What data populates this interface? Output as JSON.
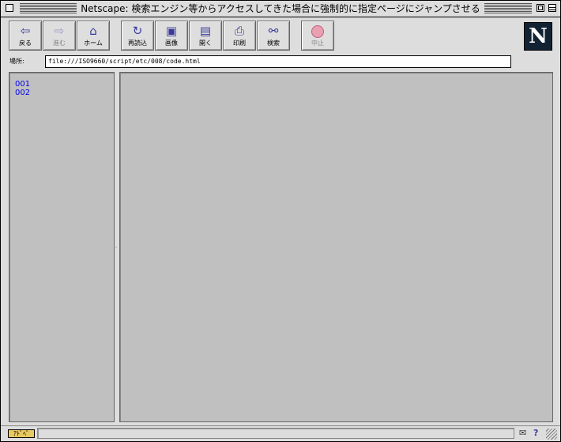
{
  "window": {
    "title": "Netscape: 検索エンジン等からアクセスしてきた場合に強制的に指定ページにジャンプさせる"
  },
  "toolbar": {
    "buttons": [
      {
        "label": "戻る",
        "icon": "back-arrow-icon"
      },
      {
        "label": "進む",
        "icon": "forward-arrow-icon"
      },
      {
        "label": "ホーム",
        "icon": "home-icon"
      },
      {
        "label": "再読込",
        "icon": "reload-icon"
      },
      {
        "label": "画像",
        "icon": "images-icon"
      },
      {
        "label": "開く",
        "icon": "open-icon"
      },
      {
        "label": "印刷",
        "icon": "print-icon"
      },
      {
        "label": "検索",
        "icon": "binoculars-icon"
      },
      {
        "label": "中止",
        "icon": "stop-icon"
      }
    ],
    "logo_letter": "N"
  },
  "location": {
    "label": "場所:",
    "url": "file:///ISO9660/script/etc/008/code.html"
  },
  "left_frame": {
    "links": [
      "001",
      "002"
    ]
  },
  "status": {
    "security_label": "ｱﾄﾞﾍﾟ",
    "help_glyph": "?"
  },
  "colors": {
    "link": "#0000ee",
    "frame_bg": "#c0c0c0",
    "chrome_bg": "#dddddd"
  }
}
